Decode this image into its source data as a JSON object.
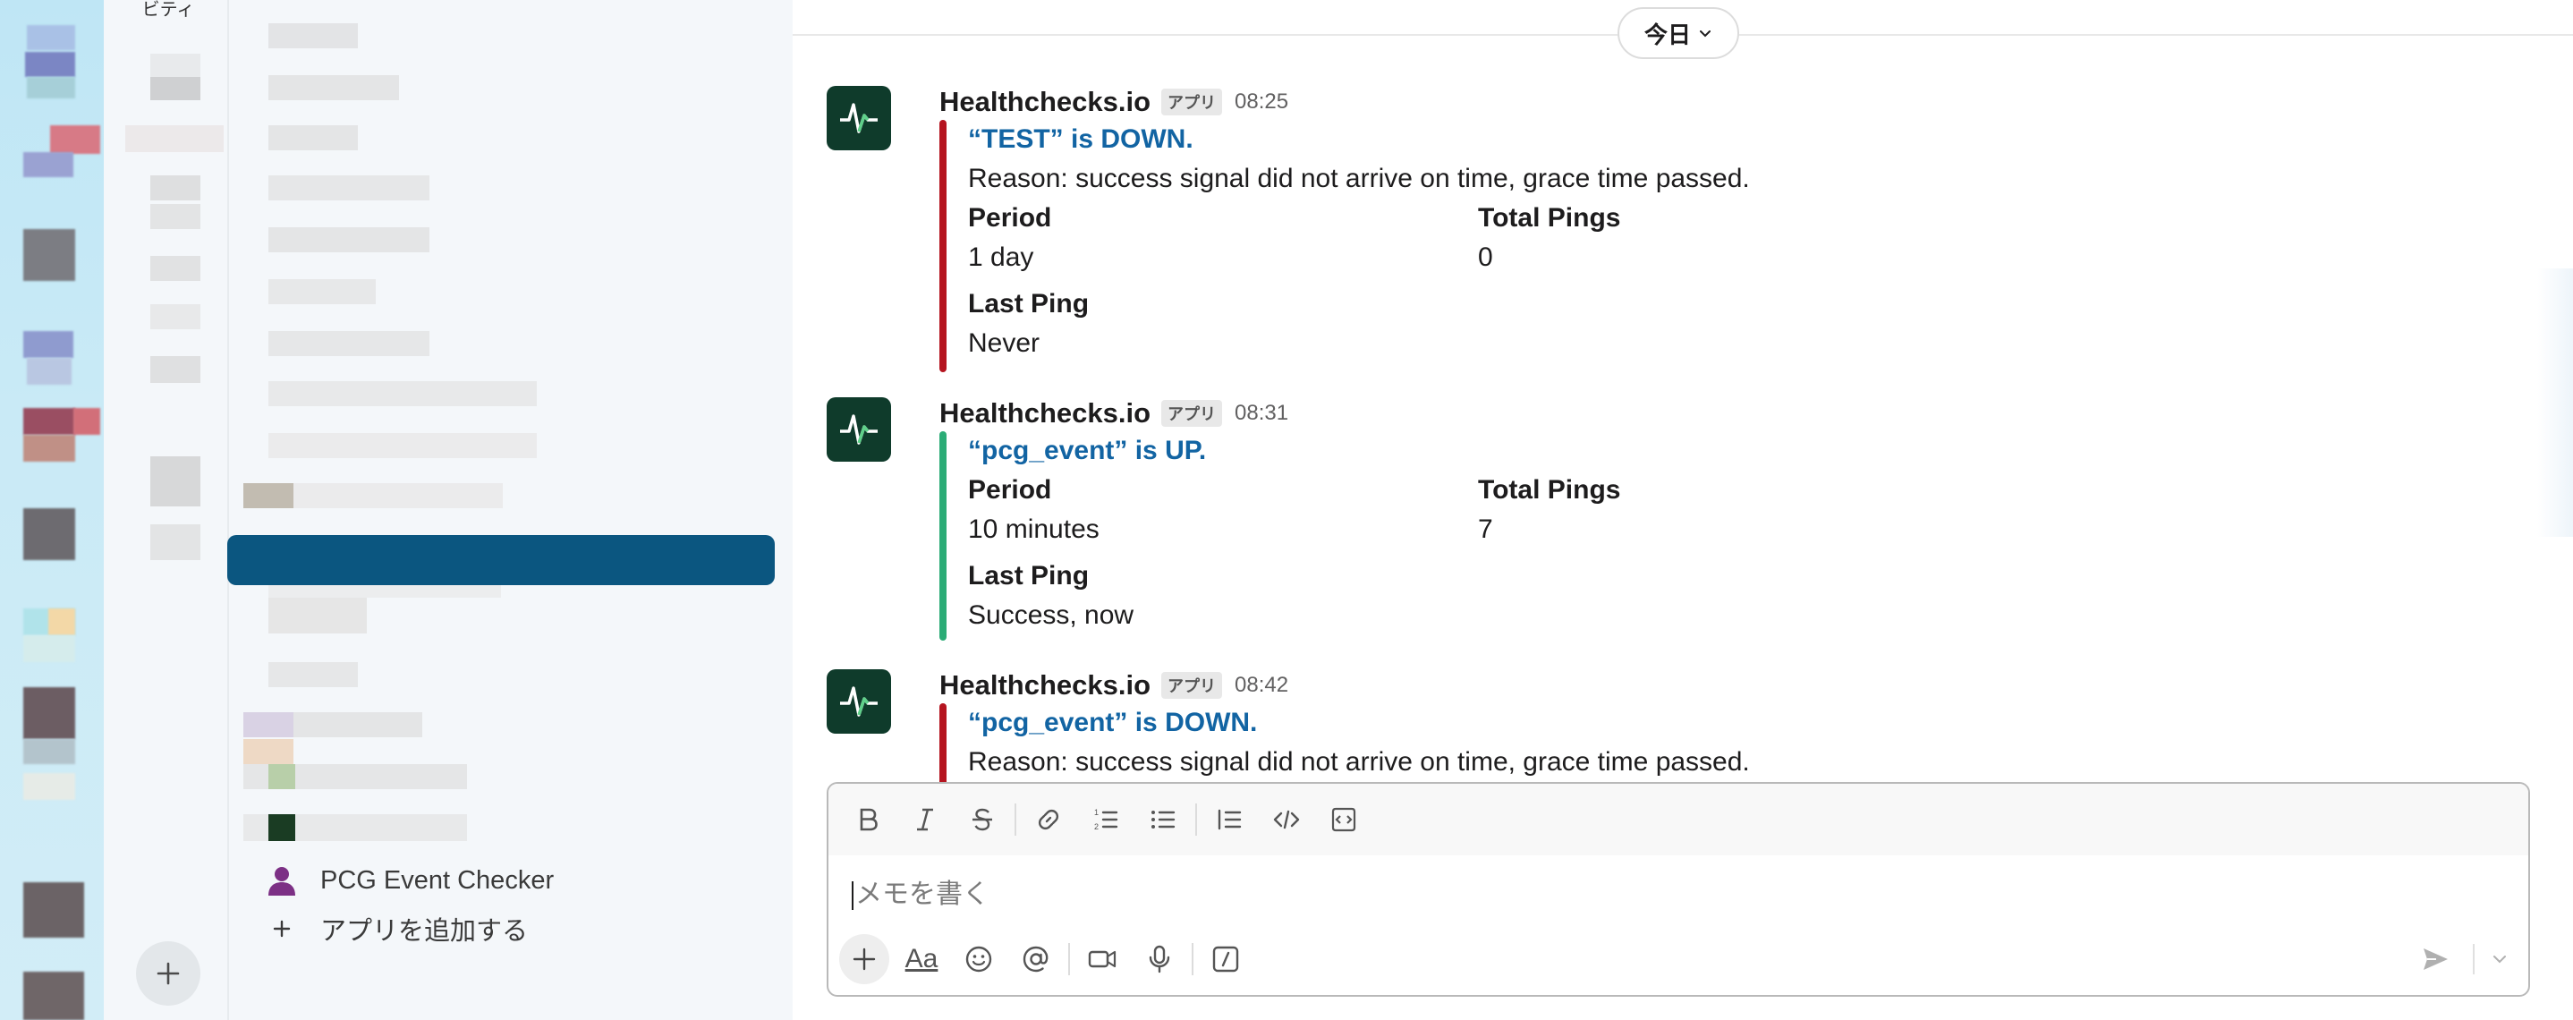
{
  "rail": {
    "partial_label": "ビティ"
  },
  "sidebar": {
    "app_item": {
      "label": "PCG Event Checker",
      "icon": "person-icon",
      "icon_color": "#7c3085"
    },
    "add_app": {
      "label": "アプリを追加する",
      "icon": "plus-icon"
    },
    "selected_color": "#0b5680"
  },
  "main": {
    "date_divider": {
      "label": "今日",
      "icon": "chevron-down-icon"
    },
    "messages": [
      {
        "sender": "Healthchecks.io",
        "badge": "アプリ",
        "time": "08:25",
        "status_color": "#b5141f",
        "title": "“TEST” is DOWN.",
        "reason": "Reason: success signal did not arrive on time, grace time passed.",
        "fields": [
          {
            "label": "Period",
            "value": "1 day"
          },
          {
            "label": "Total Pings",
            "value": "0"
          },
          {
            "label": "Last Ping",
            "value": "Never"
          }
        ]
      },
      {
        "sender": "Healthchecks.io",
        "badge": "アプリ",
        "time": "08:31",
        "status_color": "#2bac76",
        "title": "“pcg_event” is UP.",
        "reason": "",
        "fields": [
          {
            "label": "Period",
            "value": "10 minutes"
          },
          {
            "label": "Total Pings",
            "value": "7"
          },
          {
            "label": "Last Ping",
            "value": "Success, now"
          }
        ]
      },
      {
        "sender": "Healthchecks.io",
        "badge": "アプリ",
        "time": "08:42",
        "status_color": "#b5141f",
        "title": "“pcg_event” is DOWN.",
        "reason": "Reason: success signal did not arrive on time, grace time passed.",
        "fields": []
      }
    ]
  },
  "composer": {
    "placeholder": "メモを書く",
    "toolbar": [
      "bold-icon",
      "italic-icon",
      "strikethrough-icon",
      "link-icon",
      "ordered-list-icon",
      "bulleted-list-icon",
      "blockquote-icon",
      "code-icon",
      "code-block-icon"
    ],
    "bottom_tools": [
      "plus-icon",
      "text-format-icon",
      "emoji-icon",
      "mention-icon",
      "video-icon",
      "microphone-icon",
      "slash-command-icon"
    ],
    "format_label": "Aa"
  }
}
